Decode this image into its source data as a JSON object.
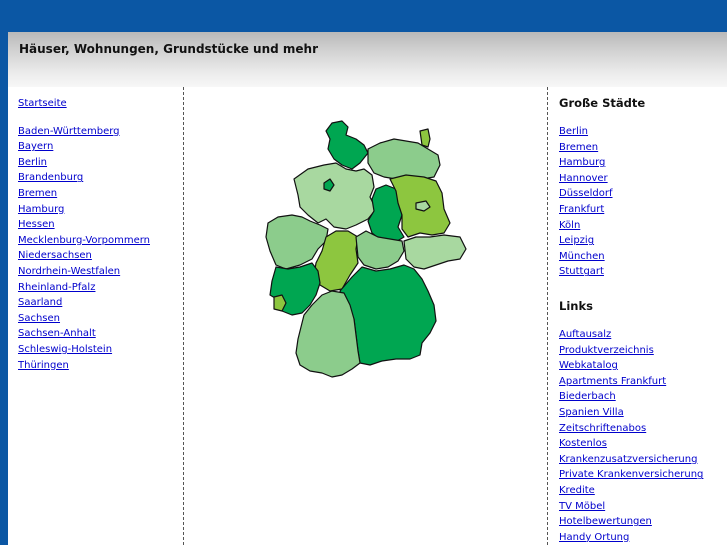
{
  "header": {
    "title": "Häuser, Wohnungen, Grundstücke und mehr"
  },
  "left_nav": {
    "home": "Startseite",
    "states": [
      "Baden-Württemberg",
      "Bayern",
      "Berlin",
      "Brandenburg",
      "Bremen",
      "Hamburg",
      "Hessen",
      "Mecklenburg-Vorpommern",
      "Niedersachsen",
      "Nordrhein-Westfalen",
      "Rheinland-Pfalz",
      "Saarland",
      "Sachsen",
      "Sachsen-Anhalt",
      "Schleswig-Holstein",
      "Thüringen"
    ]
  },
  "cities": {
    "heading": "Große Städte",
    "items": [
      "Berlin",
      "Bremen",
      "Hamburg",
      "Hannover",
      "Düsseldorf",
      "Frankfurt",
      "Köln",
      "Leipzig",
      "München",
      "Stuttgart"
    ]
  },
  "links": {
    "heading": "Links",
    "items": [
      "Auftausalz",
      "Produktverzeichnis",
      "Webkatalog",
      "Apartments Frankfurt",
      "Biederbach",
      "Spanien Villa",
      "Zeitschriftenabos",
      "Kostenlos",
      "Krankenzusatzversicherung",
      "Private Krankenversicherung",
      "Kredite",
      "TV Möbel",
      "Hotelbewertungen",
      "Handy Ortung"
    ]
  },
  "map_colors": {
    "dark": "#00a651",
    "light": "#8ccc8c",
    "pale": "#a8d8a0",
    "lime": "#8dc63f",
    "outline": "#111111"
  }
}
